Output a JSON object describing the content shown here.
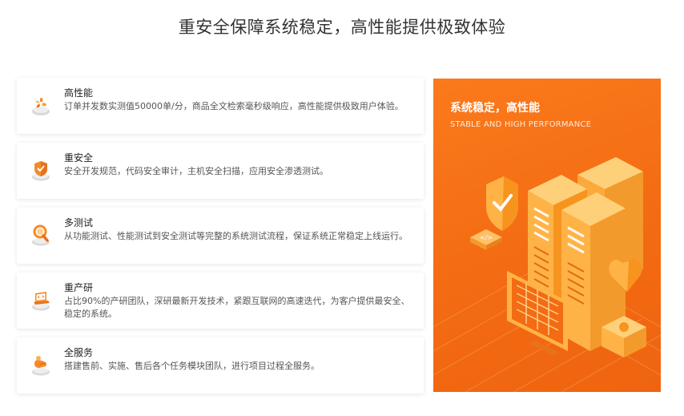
{
  "section": {
    "title": "重安全保障系统稳定，高性能提供极致体验"
  },
  "features": [
    {
      "icon": "fan-icon",
      "title": "高性能",
      "desc": "订单并发数实测值50000单/分，商品全文检索毫秒级响应，高性能提供极致用户体验。"
    },
    {
      "icon": "shield-icon",
      "title": "重安全",
      "desc": "安全开发规范，代码安全审计，主机安全扫描，应用安全渗透测试。"
    },
    {
      "icon": "magnifier-icon",
      "title": "多测试",
      "desc": "从功能测试、性能测试到安全测试等完整的系统测试流程，保证系统正常稳定上线运行。"
    },
    {
      "icon": "code-laptop-icon",
      "title": "重产研",
      "desc": "占比90%的产研团队，深研最新开发技术，紧跟互联网的高速迭代，为客户提供最安全、稳定的系统。"
    },
    {
      "icon": "hand-service-icon",
      "title": "全服务",
      "desc": "搭建售前、实施、售后各个任务模块团队，进行项目过程全服务。"
    }
  ],
  "hero": {
    "title": "系统稳定，高性能",
    "subtitle": "STABLE AND HIGH PERFORMANCE",
    "colors": {
      "accent": "#f36b12",
      "light": "#ffb347"
    }
  }
}
